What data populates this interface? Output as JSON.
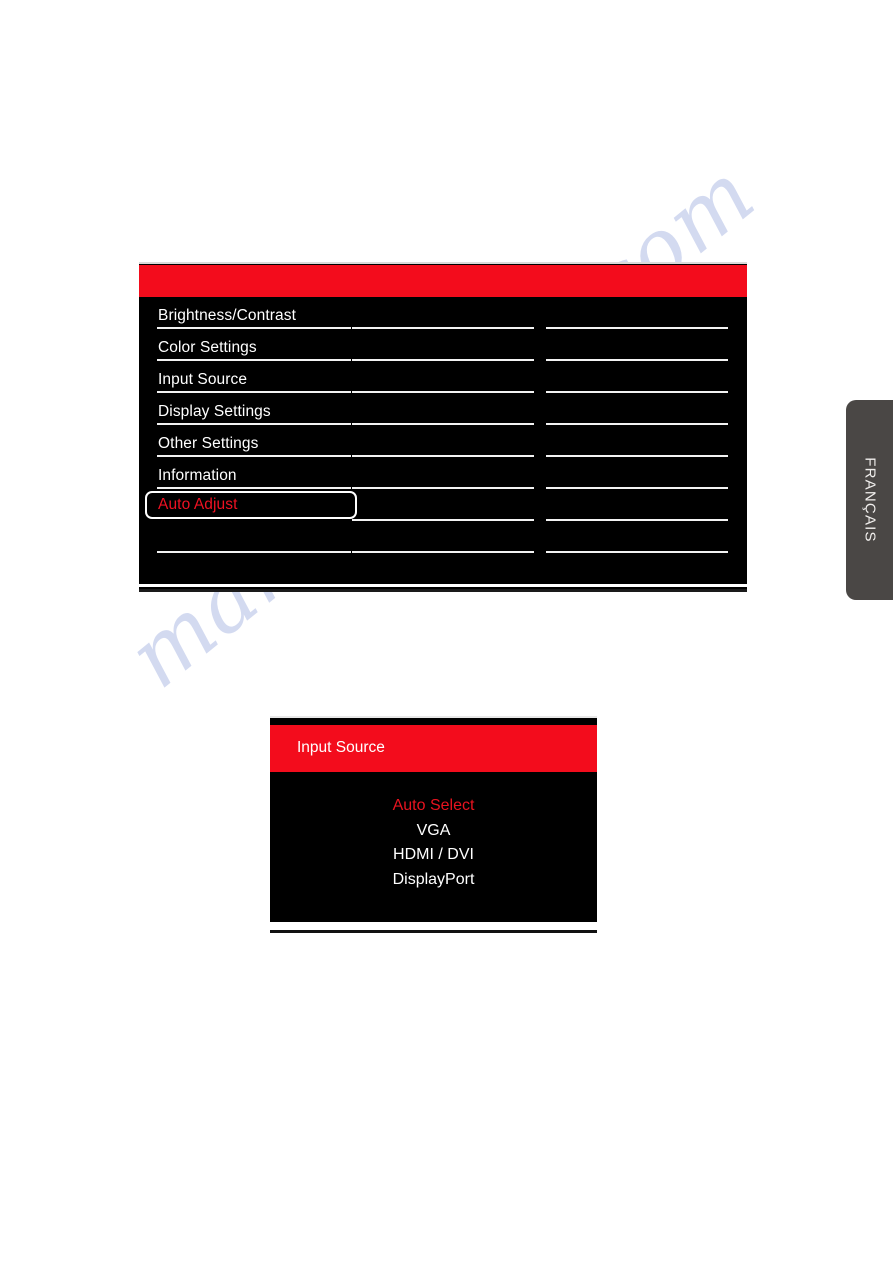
{
  "page": {
    "background_color": "#ffffff",
    "watermark_text": "manualshive.com",
    "watermark_color": "#b9c4e8"
  },
  "language_tab": {
    "label": "FRANÇAIS",
    "background_color": "#4a4745",
    "text_color": "#f0eeec"
  },
  "osd_main_menu": {
    "title_bar_text": "",
    "accent_color": "#f30c1c",
    "background_color": "#000000",
    "selected_text_color": "#ee1122",
    "rows": [
      {
        "label": "Brightness/Contrast",
        "selected": false
      },
      {
        "label": "Color Settings",
        "selected": false
      },
      {
        "label": "Input Source",
        "selected": false
      },
      {
        "label": "Display Settings",
        "selected": false
      },
      {
        "label": "Other Settings",
        "selected": false
      },
      {
        "label": "Information",
        "selected": false
      },
      {
        "label": "Auto Adjust",
        "selected": true
      },
      {
        "label": "",
        "selected": false
      }
    ]
  },
  "osd_input_source": {
    "title": "Input Source",
    "accent_color": "#f30c1c",
    "background_color": "#000000",
    "selected_text_color": "#e8131f",
    "options": [
      {
        "label": "Auto Select",
        "selected": true
      },
      {
        "label": "VGA",
        "selected": false
      },
      {
        "label": "HDMI / DVI",
        "selected": false
      },
      {
        "label": "DisplayPort",
        "selected": false
      }
    ]
  }
}
